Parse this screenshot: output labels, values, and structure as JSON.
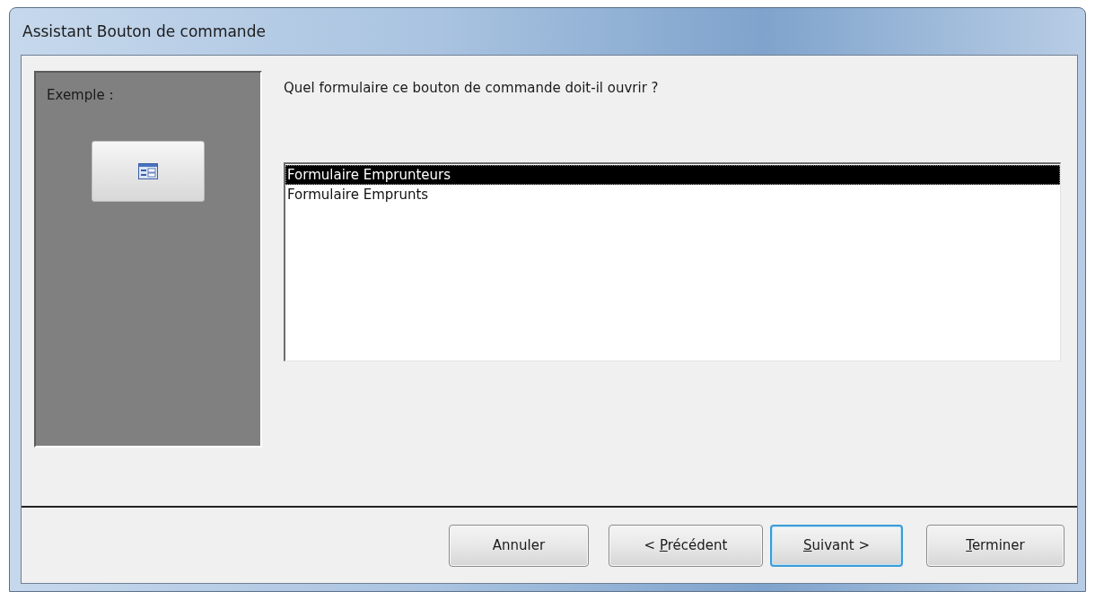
{
  "window": {
    "title": "Assistant Bouton de commande"
  },
  "example": {
    "label": "Exemple :"
  },
  "question": "Quel formulaire ce bouton de commande doit-il ouvrir ?",
  "list": {
    "items": [
      {
        "label": "Formulaire Emprunteurs",
        "selected": true
      },
      {
        "label": "Formulaire Emprunts",
        "selected": false
      }
    ]
  },
  "buttons": [
    {
      "text_before": "Annuler",
      "focused": false
    },
    {
      "text_before": "< ",
      "access_key": "P",
      "text_after": "récédent",
      "focused": false
    },
    {
      "access_key": "S",
      "text_after": "uivant >",
      "focused": true
    },
    {
      "access_key": "T",
      "text_after": "erminer",
      "focused": false
    }
  ]
}
